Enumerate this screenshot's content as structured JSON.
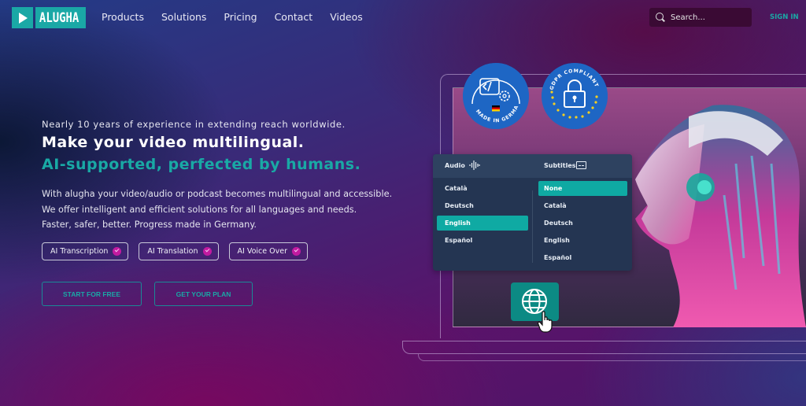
{
  "brand": {
    "name": "ALUGHA",
    "accent_color": "#1aa8a6"
  },
  "nav": {
    "links": [
      "Products",
      "Solutions",
      "Pricing",
      "Contact",
      "Videos"
    ],
    "search_placeholder": "Search...",
    "signin_label": "SIGN IN"
  },
  "hero": {
    "eyebrow": "Nearly 10 years of experience in extending reach worldwide.",
    "headline": "Make your video multilingual.",
    "subheadline": "AI-supported, perfected by humans.",
    "description": [
      "With alugha your video/audio or podcast becomes multilingual and accessible.",
      "We offer intelligent and efficient solutions for all languages and needs.",
      "Faster, safer, better. Progress made in Germany."
    ],
    "features": [
      "AI Transcription",
      "AI Translation",
      "AI Voice Over"
    ],
    "cta_primary": "START FOR FREE",
    "cta_secondary": "GET YOUR PLAN"
  },
  "badges": {
    "germany": "MADE IN GERMANY",
    "gdpr": "GDPR COMPLIANT"
  },
  "language_panel": {
    "audio_label": "Audio",
    "subtitles_label": "Subtitles",
    "audio_options": [
      "Català",
      "Deutsch",
      "English",
      "Español"
    ],
    "audio_selected": "English",
    "subtitle_options": [
      "None",
      "Català",
      "Deutsch",
      "English",
      "Español"
    ],
    "subtitle_selected": "None"
  }
}
